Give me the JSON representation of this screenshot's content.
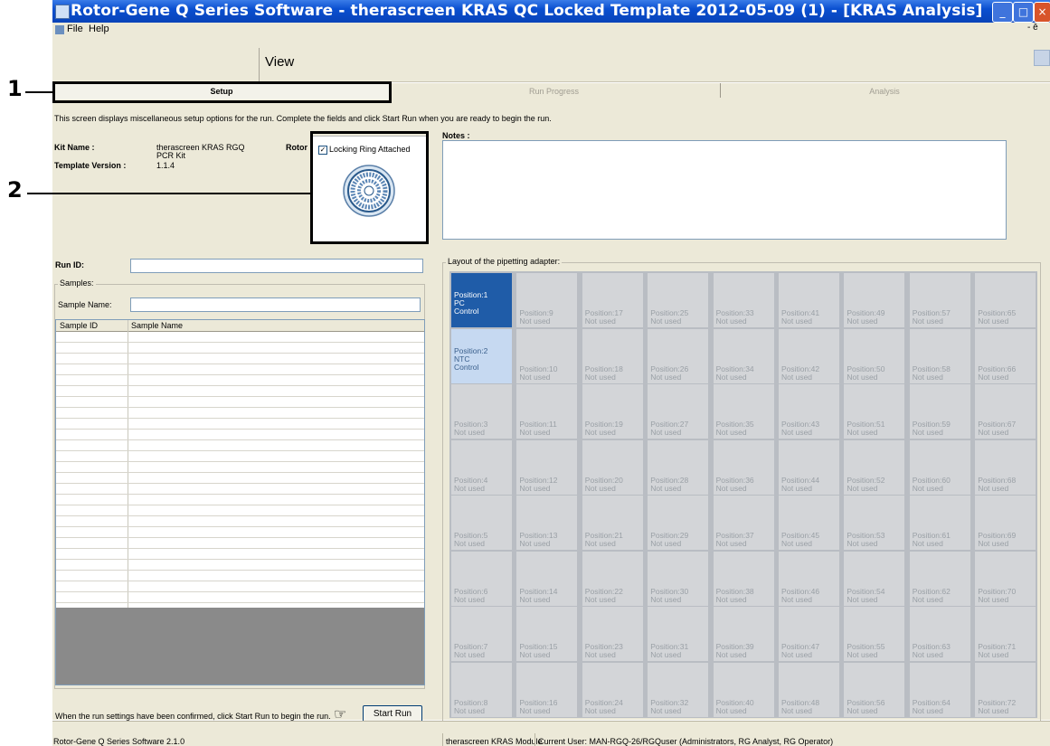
{
  "window": {
    "title": "Rotor-Gene Q Series Software - therascreen KRAS QC Locked Template 2012-05-09 (1) - [KRAS Analysis]",
    "buttons": [
      "_",
      "□",
      "×"
    ]
  },
  "menu": {
    "items": [
      "File",
      "Help"
    ],
    "restore_hint": "- ē"
  },
  "toolbar": {
    "view_label": "View"
  },
  "tabs": [
    {
      "label": "Setup",
      "active": true
    },
    {
      "label": "Run Progress",
      "active": false
    },
    {
      "label": "Analysis",
      "active": false
    }
  ],
  "setup": {
    "description": "This screen displays miscellaneous setup options for the run. Complete the fields and click Start Run when you are ready to begin the run.",
    "kit_name_label": "Kit Name :",
    "kit_name_value": "therascreen KRAS RGQ",
    "kit_name_value_2": "PCR Kit",
    "template_version_label": "Template Version :",
    "template_version_value": "1.1.4",
    "rotor_label": "Rotor :",
    "locking_ring_label": "Locking Ring Attached",
    "locking_ring_checked": true,
    "notes_label": "Notes :",
    "notes_value": "",
    "run_id_label": "Run ID:",
    "run_id_value": "",
    "samples_group_label": "Samples:",
    "sample_name_label": "Sample Name:",
    "sample_name_value": "",
    "table_headers": [
      "Sample ID",
      "Sample Name"
    ],
    "confirm_text": "When the run settings have been confirmed, click Start Run to begin the run.",
    "start_run_label": "Start Run",
    "layout_label": "Layout of the pipetting adapter:"
  },
  "positions": [
    {
      "id": 1,
      "line1": "Position:1",
      "line2": "PC",
      "line3": "Control",
      "state": "pc"
    },
    {
      "id": 2,
      "line1": "Position:2",
      "line2": "NTC",
      "line3": "Control",
      "state": "ntc"
    },
    {
      "id": 3,
      "line1": "Position:3",
      "line2": "Not used"
    },
    {
      "id": 4,
      "line1": "Position:4",
      "line2": "Not used"
    },
    {
      "id": 5,
      "line1": "Position:5",
      "line2": "Not used"
    },
    {
      "id": 6,
      "line1": "Position:6",
      "line2": "Not used"
    },
    {
      "id": 7,
      "line1": "Position:7",
      "line2": "Not used"
    },
    {
      "id": 8,
      "line1": "Position:8",
      "line2": "Not used"
    },
    {
      "id": 9,
      "line1": "Position:9",
      "line2": "Not used"
    },
    {
      "id": 10,
      "line1": "Position:10",
      "line2": "Not used"
    },
    {
      "id": 11,
      "line1": "Position:11",
      "line2": "Not used"
    },
    {
      "id": 12,
      "line1": "Position:12",
      "line2": "Not used"
    },
    {
      "id": 13,
      "line1": "Position:13",
      "line2": "Not used"
    },
    {
      "id": 14,
      "line1": "Position:14",
      "line2": "Not used"
    },
    {
      "id": 15,
      "line1": "Position:15",
      "line2": "Not used"
    },
    {
      "id": 16,
      "line1": "Position:16",
      "line2": "Not used"
    },
    {
      "id": 17,
      "line1": "Position:17",
      "line2": "Not used"
    },
    {
      "id": 18,
      "line1": "Position:18",
      "line2": "Not used"
    },
    {
      "id": 19,
      "line1": "Position:19",
      "line2": "Not used"
    },
    {
      "id": 20,
      "line1": "Position:20",
      "line2": "Not used"
    },
    {
      "id": 21,
      "line1": "Position:21",
      "line2": "Not used"
    },
    {
      "id": 22,
      "line1": "Position:22",
      "line2": "Not used"
    },
    {
      "id": 23,
      "line1": "Position:23",
      "line2": "Not used"
    },
    {
      "id": 24,
      "line1": "Position:24",
      "line2": "Not used"
    },
    {
      "id": 25,
      "line1": "Position:25",
      "line2": "Not used"
    },
    {
      "id": 26,
      "line1": "Position:26",
      "line2": "Not used"
    },
    {
      "id": 27,
      "line1": "Position:27",
      "line2": "Not used"
    },
    {
      "id": 28,
      "line1": "Position:28",
      "line2": "Not used"
    },
    {
      "id": 29,
      "line1": "Position:29",
      "line2": "Not used"
    },
    {
      "id": 30,
      "line1": "Position:30",
      "line2": "Not used"
    },
    {
      "id": 31,
      "line1": "Position:31",
      "line2": "Not used"
    },
    {
      "id": 32,
      "line1": "Position:32",
      "line2": "Not used"
    },
    {
      "id": 33,
      "line1": "Position:33",
      "line2": "Not used"
    },
    {
      "id": 34,
      "line1": "Position:34",
      "line2": "Not used"
    },
    {
      "id": 35,
      "line1": "Position:35",
      "line2": "Not used"
    },
    {
      "id": 36,
      "line1": "Position:36",
      "line2": "Not used"
    },
    {
      "id": 37,
      "line1": "Position:37",
      "line2": "Not used"
    },
    {
      "id": 38,
      "line1": "Position:38",
      "line2": "Not used"
    },
    {
      "id": 39,
      "line1": "Position:39",
      "line2": "Not used"
    },
    {
      "id": 40,
      "line1": "Position:40",
      "line2": "Not used"
    },
    {
      "id": 41,
      "line1": "Position:41",
      "line2": "Not used"
    },
    {
      "id": 42,
      "line1": "Position:42",
      "line2": "Not used"
    },
    {
      "id": 43,
      "line1": "Position:43",
      "line2": "Not used"
    },
    {
      "id": 44,
      "line1": "Position:44",
      "line2": "Not used"
    },
    {
      "id": 45,
      "line1": "Position:45",
      "line2": "Not used"
    },
    {
      "id": 46,
      "line1": "Position:46",
      "line2": "Not used"
    },
    {
      "id": 47,
      "line1": "Position:47",
      "line2": "Not used"
    },
    {
      "id": 48,
      "line1": "Position:48",
      "line2": "Not used"
    },
    {
      "id": 49,
      "line1": "Position:49",
      "line2": "Not used"
    },
    {
      "id": 50,
      "line1": "Position:50",
      "line2": "Not used"
    },
    {
      "id": 51,
      "line1": "Position:51",
      "line2": "Not used"
    },
    {
      "id": 52,
      "line1": "Position:52",
      "line2": "Not used"
    },
    {
      "id": 53,
      "line1": "Position:53",
      "line2": "Not used"
    },
    {
      "id": 54,
      "line1": "Position:54",
      "line2": "Not used"
    },
    {
      "id": 55,
      "line1": "Position:55",
      "line2": "Not used"
    },
    {
      "id": 56,
      "line1": "Position:56",
      "line2": "Not used"
    },
    {
      "id": 57,
      "line1": "Position:57",
      "line2": "Not used"
    },
    {
      "id": 58,
      "line1": "Position:58",
      "line2": "Not used"
    },
    {
      "id": 59,
      "line1": "Position:59",
      "line2": "Not used"
    },
    {
      "id": 60,
      "line1": "Position:60",
      "line2": "Not used"
    },
    {
      "id": 61,
      "line1": "Position:61",
      "line2": "Not used"
    },
    {
      "id": 62,
      "line1": "Position:62",
      "line2": "Not used"
    },
    {
      "id": 63,
      "line1": "Position:63",
      "line2": "Not used"
    },
    {
      "id": 64,
      "line1": "Position:64",
      "line2": "Not used"
    },
    {
      "id": 65,
      "line1": "Position:65",
      "line2": "Not used"
    },
    {
      "id": 66,
      "line1": "Position:66",
      "line2": "Not used"
    },
    {
      "id": 67,
      "line1": "Position:67",
      "line2": "Not used"
    },
    {
      "id": 68,
      "line1": "Position:68",
      "line2": "Not used"
    },
    {
      "id": 69,
      "line1": "Position:69",
      "line2": "Not used"
    },
    {
      "id": 70,
      "line1": "Position:70",
      "line2": "Not used"
    },
    {
      "id": 71,
      "line1": "Position:71",
      "line2": "Not used"
    },
    {
      "id": 72,
      "line1": "Position:72",
      "line2": "Not used"
    }
  ],
  "status": {
    "version": "Rotor-Gene Q Series Software 2.1.0",
    "module": "therascreen KRAS Module",
    "user": "Current User: MAN-RGQ-26/RGQuser (Administrators, RG Analyst, RG Operator)"
  },
  "annotations": [
    "1",
    "2"
  ],
  "colors": {
    "title_blue": "#0a4fd0",
    "pc_cell": "#1f5ca8",
    "ntc_cell": "#c6d9f1",
    "chrome": "#ece9d8"
  }
}
